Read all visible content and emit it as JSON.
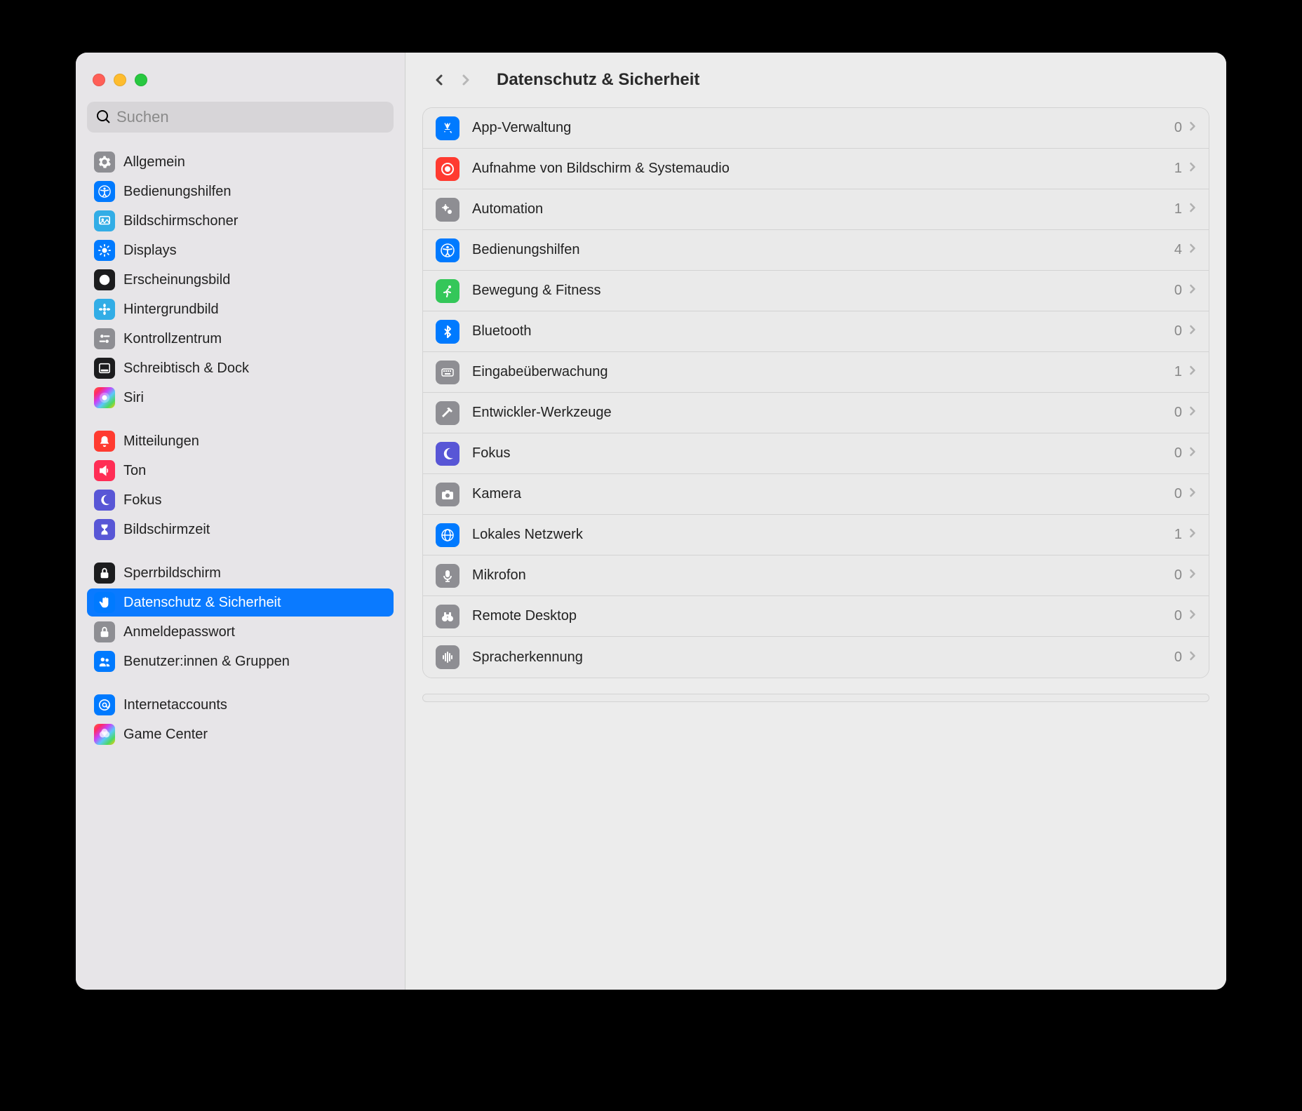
{
  "window": {
    "search_placeholder": "Suchen",
    "page_title": "Datenschutz & Sicherheit"
  },
  "sidebar": {
    "groups": [
      {
        "items": [
          {
            "id": "general",
            "label": "Allgemein",
            "icon": "gear",
            "bg": "bg-gray",
            "selected": false
          },
          {
            "id": "accessibility",
            "label": "Bedienungshilfen",
            "icon": "accessibility",
            "bg": "bg-blue",
            "selected": false
          },
          {
            "id": "screensaver",
            "label": "Bildschirmschoner",
            "icon": "screensaver",
            "bg": "bg-lblue",
            "selected": false
          },
          {
            "id": "displays",
            "label": "Displays",
            "icon": "sun",
            "bg": "bg-blue",
            "selected": false
          },
          {
            "id": "appearance",
            "label": "Erscheinungsbild",
            "icon": "appearance",
            "bg": "bg-black",
            "selected": false
          },
          {
            "id": "wallpaper",
            "label": "Hintergrundbild",
            "icon": "flower",
            "bg": "bg-lblue",
            "selected": false
          },
          {
            "id": "controlcenter",
            "label": "Kontrollzentrum",
            "icon": "switches",
            "bg": "bg-gray",
            "selected": false
          },
          {
            "id": "dock",
            "label": "Schreibtisch & Dock",
            "icon": "dock",
            "bg": "bg-black",
            "selected": false
          },
          {
            "id": "siri",
            "label": "Siri",
            "icon": "siri",
            "bg": "bg-grad",
            "selected": false
          }
        ]
      },
      {
        "items": [
          {
            "id": "notifications",
            "label": "Mitteilungen",
            "icon": "bell",
            "bg": "bg-red",
            "selected": false
          },
          {
            "id": "sound",
            "label": "Ton",
            "icon": "speaker",
            "bg": "bg-pink",
            "selected": false
          },
          {
            "id": "focus",
            "label": "Fokus",
            "icon": "moon",
            "bg": "bg-indigo",
            "selected": false
          },
          {
            "id": "screentime",
            "label": "Bildschirmzeit",
            "icon": "hourglass",
            "bg": "bg-indigo",
            "selected": false
          }
        ]
      },
      {
        "items": [
          {
            "id": "lockscreen",
            "label": "Sperrbildschirm",
            "icon": "lock",
            "bg": "bg-black",
            "selected": false
          },
          {
            "id": "privacy",
            "label": "Datenschutz & Sicherheit",
            "icon": "hand",
            "bg": "bg-blue",
            "selected": true
          },
          {
            "id": "loginpassword",
            "label": "Anmeldepasswort",
            "icon": "lock",
            "bg": "bg-gray",
            "selected": false
          },
          {
            "id": "users",
            "label": "Benutzer:innen & Gruppen",
            "icon": "people",
            "bg": "bg-blue",
            "selected": false
          }
        ]
      },
      {
        "items": [
          {
            "id": "internetaccounts",
            "label": "Internetaccounts",
            "icon": "at",
            "bg": "bg-blue",
            "selected": false
          },
          {
            "id": "gamecenter",
            "label": "Game Center",
            "icon": "gamecenter",
            "bg": "bg-grad",
            "selected": false
          }
        ]
      }
    ]
  },
  "rows": [
    {
      "id": "app-management",
      "label": "App-Verwaltung",
      "count": "0",
      "icon": "appstore",
      "bg": "bg-blue"
    },
    {
      "id": "screen-recording",
      "label": "Aufnahme von Bildschirm & Systemaudio",
      "count": "1",
      "icon": "record",
      "bg": "bg-red"
    },
    {
      "id": "automation",
      "label": "Automation",
      "count": "1",
      "icon": "gears",
      "bg": "bg-gray"
    },
    {
      "id": "accessibility",
      "label": "Bedienungshilfen",
      "count": "4",
      "icon": "accessibility",
      "bg": "bg-blue"
    },
    {
      "id": "motion",
      "label": "Bewegung & Fitness",
      "count": "0",
      "icon": "running",
      "bg": "bg-green"
    },
    {
      "id": "bluetooth",
      "label": "Bluetooth",
      "count": "0",
      "icon": "bluetooth",
      "bg": "bg-blue"
    },
    {
      "id": "input-monitoring",
      "label": "Eingabeüberwachung",
      "count": "1",
      "icon": "keyboard",
      "bg": "bg-gray"
    },
    {
      "id": "dev-tools",
      "label": "Entwickler-Werkzeuge",
      "count": "0",
      "icon": "hammer",
      "bg": "bg-gray"
    },
    {
      "id": "focus",
      "label": "Fokus",
      "count": "0",
      "icon": "moon",
      "bg": "bg-indigo"
    },
    {
      "id": "camera",
      "label": "Kamera",
      "count": "0",
      "icon": "camera",
      "bg": "bg-gray"
    },
    {
      "id": "local-network",
      "label": "Lokales Netzwerk",
      "count": "1",
      "icon": "globe",
      "bg": "bg-blue"
    },
    {
      "id": "microphone",
      "label": "Mikrofon",
      "count": "0",
      "icon": "mic",
      "bg": "bg-gray"
    },
    {
      "id": "remote-desktop",
      "label": "Remote Desktop",
      "count": "0",
      "icon": "binoculars",
      "bg": "bg-gray"
    },
    {
      "id": "speech",
      "label": "Spracherkennung",
      "count": "0",
      "icon": "waveform",
      "bg": "bg-gray"
    }
  ]
}
